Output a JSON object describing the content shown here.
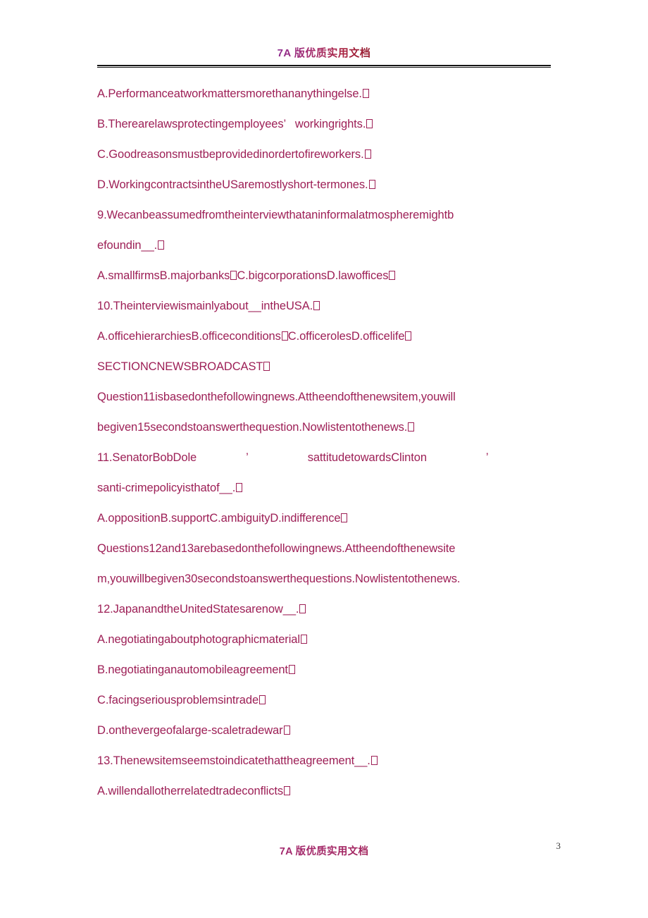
{
  "header": {
    "watermark": "7A 版优质实用文档"
  },
  "footer": {
    "watermark": "7A 版优质实用文档",
    "page_number": "3"
  },
  "colors": {
    "body_text": "#9d1f56",
    "header_gradient_start": "#8e2a8e",
    "header_gradient_end": "#951a2e",
    "rule": "#141414",
    "page_number": "#3a3a3a"
  },
  "body": {
    "lines": [
      {
        "id": "opt-8a",
        "text": "A.Performanceatworkmattersmorethananythingelse.",
        "tofu_end": true
      },
      {
        "id": "opt-8b",
        "text": "B.Therearelawsprotectingemployees’   workingrights.",
        "tofu_end": true
      },
      {
        "id": "opt-8c",
        "text": "C.Goodreasonsmustbeprovidedinordertofireworkers.",
        "tofu_end": true
      },
      {
        "id": "opt-8d",
        "text": "D.WorkingcontractsintheUSaremostlyshort-termones.",
        "tofu_end": true
      },
      {
        "id": "q9-line1",
        "text": "9.Wecanbeassumedfromtheinterviewthataninformalatmospheremightb",
        "tofu_end": false
      },
      {
        "id": "q9-line2",
        "text": "efoundin__.",
        "tofu_end": true
      },
      {
        "id": "opt-9",
        "text": "A.smallfirmsB.majorbanks",
        "text2": "C.bigcorporationsD.lawoffices",
        "tofu_mid": true,
        "tofu_end": true
      },
      {
        "id": "q10",
        "text": "10.Theinterviewismainlyabout__intheUSA.",
        "tofu_end": true
      },
      {
        "id": "opt-10",
        "text": "A.officehierarchiesB.officeconditions",
        "text2": "C.officerolesD.officelife",
        "tofu_mid": true,
        "tofu_end": true
      },
      {
        "id": "section-c",
        "text": "SECTIONCNEWSBROADCAST",
        "tofu_end": true
      },
      {
        "id": "q11-intro1",
        "text": "Question11isbasedonthefollowingnews.Attheendofthenewsitem,youwill",
        "tofu_end": false
      },
      {
        "id": "q11-intro2",
        "text": "begiven15secondstoanswerthequestion.Nowlistentothenews.",
        "tofu_end": true
      },
      {
        "id": "q11-line1",
        "segments": [
          "11.SenatorBobDole",
          "’",
          "sattitudetowardsClinton",
          "’"
        ],
        "tofu_end": false
      },
      {
        "id": "q11-line2",
        "text": "santi-crimepolicyisthatof__.",
        "tofu_end": true
      },
      {
        "id": "opt-11",
        "text": "A.oppositionB.supportC.ambiguityD.indifference",
        "tofu_end": true
      },
      {
        "id": "q1213-intro1",
        "text": "Questions12and13arebasedonthefollowingnews.Attheendofthenewsite",
        "tofu_end": false
      },
      {
        "id": "q1213-intro2",
        "text": "m,youwillbegiven30secondstoanswerthequestions.Nowlistentothenews.",
        "tofu_end": false
      },
      {
        "id": "q12",
        "text": "12.JapanandtheUnitedStatesarenow__.",
        "tofu_end": true
      },
      {
        "id": "opt-12a",
        "text": "A.negotiatingaboutphotographicmaterial",
        "tofu_end": true
      },
      {
        "id": "opt-12b",
        "text": "B.negotiatinganautomobileagreement",
        "tofu_end": true
      },
      {
        "id": "opt-12c",
        "text": "C.facingseriousproblemsintrade",
        "tofu_end": true
      },
      {
        "id": "opt-12d",
        "text": "D.onthevergeofalarge-scaletradewar",
        "tofu_end": true
      },
      {
        "id": "q13",
        "text": "13.Thenewsitemseemstoindicatethattheagreement__.",
        "tofu_end": true
      },
      {
        "id": "opt-13a",
        "text": "A.willendallotherrelatedtradeconflicts",
        "tofu_end": true
      }
    ]
  }
}
